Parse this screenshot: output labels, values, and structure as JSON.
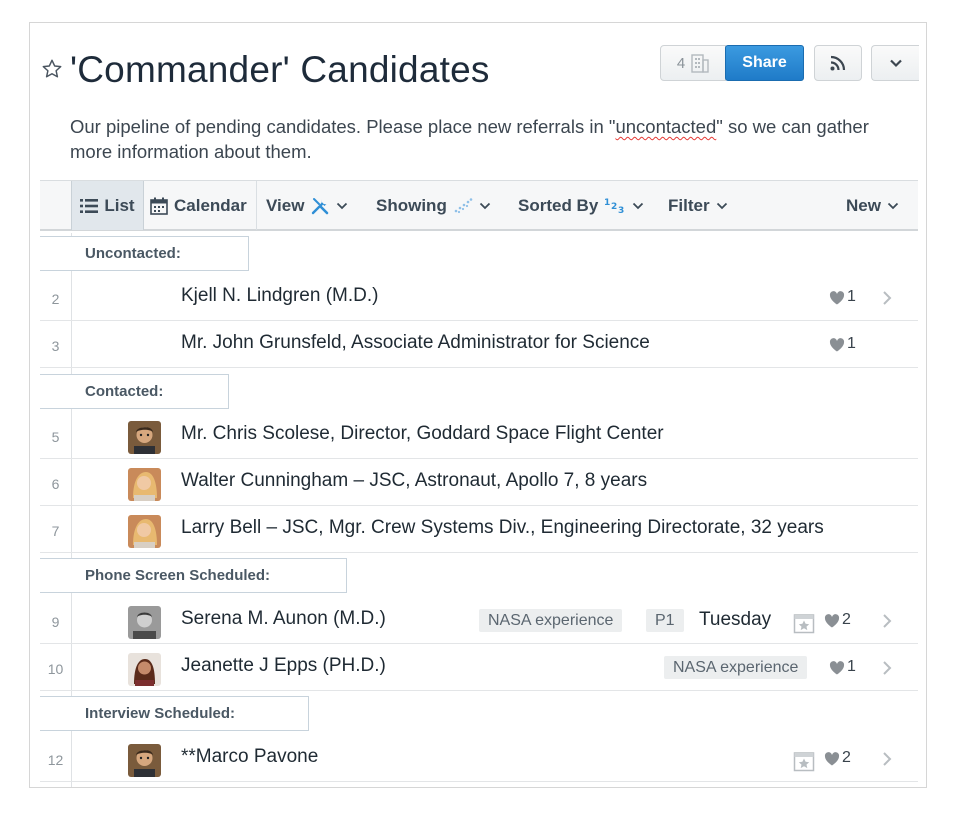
{
  "header": {
    "title": "'Commander' Candidates",
    "description_before": "Our pipeline of pending candidates. Please place new referrals in \"",
    "description_spell": "uncontacted",
    "description_after": "\" so we can gather more information about them.",
    "count": "4",
    "share_label": "Share"
  },
  "toolbar": {
    "list_label": "List",
    "calendar_label": "Calendar",
    "view_label": "View",
    "showing_label": "Showing",
    "sorted_label": "Sorted By",
    "filter_label": "Filter",
    "new_label": "New"
  },
  "groups": [
    {
      "label": "Uncontacted:"
    },
    {
      "label": "Contacted:"
    },
    {
      "label": "Phone Screen Scheduled:"
    },
    {
      "label": "Interview Scheduled:"
    }
  ],
  "rows": [
    {
      "num": "2",
      "name": "Kjell N. Lindgren (M.D.)",
      "hearts": "1"
    },
    {
      "num": "3",
      "name": "Mr. John Grunsfeld, Associate Administrator for Science",
      "hearts": "1"
    },
    {
      "num": "5",
      "name": "Mr. Chris Scolese, Director, Goddard Space Flight Center"
    },
    {
      "num": "6",
      "name": "Walter Cunningham – JSC, Astronaut, Apollo 7, 8 years"
    },
    {
      "num": "7",
      "name": "Larry Bell – JSC, Mgr. Crew Systems Div., Engineering Directorate, 32 years"
    },
    {
      "num": "9",
      "name": "Serena M. Aunon (M.D.)",
      "tag1": "NASA experience",
      "tag2": "P1",
      "day": "Tuesday",
      "hearts": "2"
    },
    {
      "num": "10",
      "name": "Jeanette J Epps (PH.D.)",
      "tag1": "NASA experience",
      "hearts": "1"
    },
    {
      "num": "12",
      "name": "**Marco Pavone",
      "hearts": "2"
    }
  ],
  "colors": {
    "accent": "#1f7bc8",
    "group_border": "#c8d3dc"
  },
  "icons": [
    "star-icon",
    "building-icon",
    "rss-icon",
    "chevron-down-icon",
    "list-icon",
    "calendar-icon",
    "tools-icon",
    "dots-icon",
    "sort-numeric-icon",
    "heart-icon",
    "calendar-star-icon",
    "chevron-right-icon"
  ]
}
